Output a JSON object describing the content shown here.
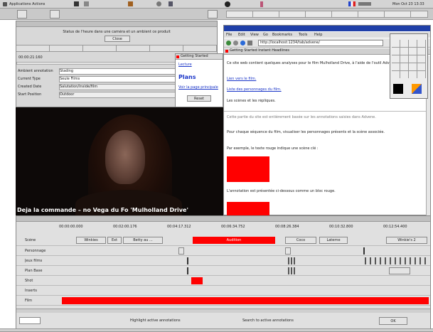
{
  "panel": {
    "title": "Applications  Actions",
    "clock": "Mon Oct 23  13:33"
  },
  "left_window": {
    "hint": "Status de l'heure dans une caméra et un ambient ce produit",
    "close_label": "Close",
    "timecode": "00:00:21:160",
    "fields": [
      {
        "label": "Ambient annotation",
        "value": "Stading"
      },
      {
        "label": "Current Type",
        "value": "Seule Films"
      },
      {
        "label": "Created Date",
        "value": "Salutation/Inside/film"
      },
      {
        "label": "Start Position",
        "value": "Outdoor"
      }
    ]
  },
  "video": {
    "subtitle": "Deja la commande – no Vega du Fo 'Mulholland Drive'"
  },
  "middle_window": {
    "tab": "Getting Started",
    "lines": [
      "Lecture",
      "Ajouter un filtre"
    ],
    "heading": "Plans",
    "link": "Voir la page principale",
    "button": "Reset"
  },
  "browser": {
    "menu": [
      "File",
      "Edit",
      "View",
      "Go",
      "Bookmarks",
      "Tools",
      "Help"
    ],
    "url": "http://localhost:1234/tab/advene/",
    "tab_title": "Getting Started   Instant Headlines",
    "paragraphs": [
      "Ce site web contient quelques analyses pour le film Mulholland Drive, à l'aide de l'outil Advene.",
      "Lien vers le film.",
      "Liste des personnages du film.",
      "Les scènes et les répliques.",
      "Cette partie du site est entièrement basée sur les annotations saisies dans Advene.",
      "Pour chaque séquence du film, visualiser les personnages présents et la scène associée.",
      "Par exemple, le texte rouge indique une scène clé :",
      "L'annotation est présentée ci-dessous comme un bloc rouge."
    ]
  },
  "timeline": {
    "ticks": [
      "00:00:00.000",
      "00:02:00.176",
      "00:04:17.312",
      "00:06:34.752",
      "00:08:26.384",
      "00:10:32.800",
      "00:12:54.400"
    ],
    "tracks": [
      "Scène",
      "Personnage",
      "Jeux films",
      "Plan Base",
      "Shot",
      "Inserts",
      "Film"
    ],
    "scene_labels": [
      "Winkies",
      "Ext",
      "Betty au ...",
      "Audition",
      "Coco",
      "Laterne",
      "Winkie's 2"
    ],
    "footer": [
      "Highlight active annotations",
      "Search to active annotations",
      "OK"
    ]
  },
  "colors": {
    "accent": "#ff0000",
    "titlebar": "#1f3fa8",
    "panel": "#cfcfcf"
  }
}
